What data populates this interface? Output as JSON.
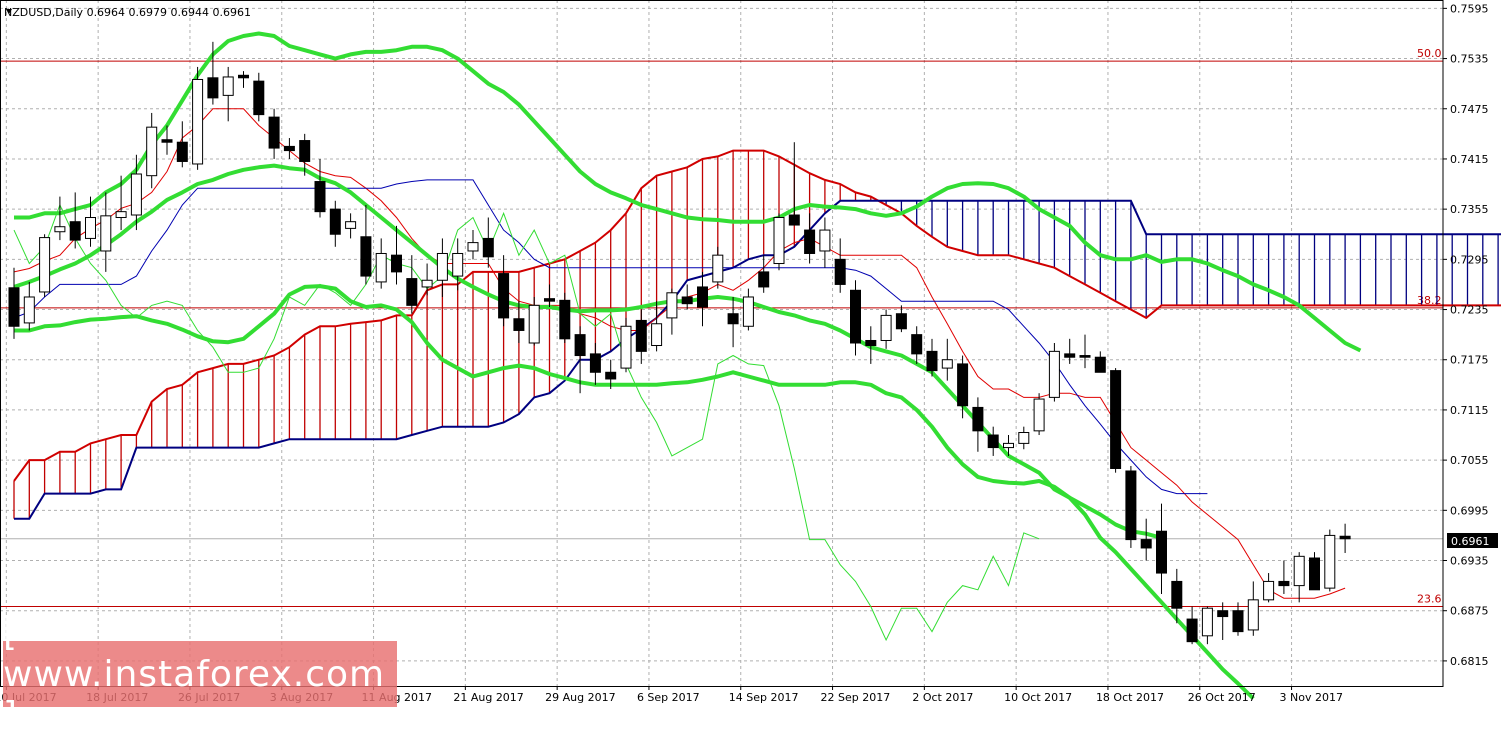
{
  "chart_data": {
    "type": "candlestick",
    "title": "NZDUSD,Daily  0.6964  0.6979  0.6944  0.6961",
    "symbol": "NZDUSD",
    "timeframe": "Daily",
    "last_price": "0.6961",
    "ylim": [
      0.6785,
      0.7605
    ],
    "y_ticks": [
      "0.7595",
      "0.7535",
      "0.7475",
      "0.7415",
      "0.7355",
      "0.7295",
      "0.7235",
      "0.7175",
      "0.7115",
      "0.7055",
      "0.6995",
      "0.6935",
      "0.6875",
      "0.6815"
    ],
    "x_ticks": [
      "10 Jul 2017",
      "18 Jul 2017",
      "26 Jul 2017",
      "3 Aug 2017",
      "11 Aug 2017",
      "21 Aug 2017",
      "29 Aug 2017",
      "6 Sep 2017",
      "14 Sep 2017",
      "22 Sep 2017",
      "2 Oct 2017",
      "10 Oct 2017",
      "18 Oct 2017",
      "26 Oct 2017",
      "3 Nov 2017"
    ],
    "fib_levels": [
      {
        "label": "50.0",
        "price": 0.7532
      },
      {
        "label": "38.2",
        "price": 0.7237
      },
      {
        "label": "23.6",
        "price": 0.688
      }
    ],
    "candles": [
      {
        "o": 0.7261,
        "h": 0.7285,
        "l": 0.72,
        "c": 0.7215
      },
      {
        "o": 0.7219,
        "h": 0.7268,
        "l": 0.721,
        "c": 0.725
      },
      {
        "o": 0.7256,
        "h": 0.7325,
        "l": 0.725,
        "c": 0.7321
      },
      {
        "o": 0.7328,
        "h": 0.737,
        "l": 0.7318,
        "c": 0.7334
      },
      {
        "o": 0.734,
        "h": 0.7375,
        "l": 0.7308,
        "c": 0.7318
      },
      {
        "o": 0.732,
        "h": 0.737,
        "l": 0.731,
        "c": 0.7345
      },
      {
        "o": 0.7305,
        "h": 0.7375,
        "l": 0.728,
        "c": 0.7347
      },
      {
        "o": 0.7345,
        "h": 0.7395,
        "l": 0.733,
        "c": 0.7352
      },
      {
        "o": 0.7348,
        "h": 0.742,
        "l": 0.733,
        "c": 0.7397
      },
      {
        "o": 0.7395,
        "h": 0.747,
        "l": 0.738,
        "c": 0.7453
      },
      {
        "o": 0.7438,
        "h": 0.7455,
        "l": 0.742,
        "c": 0.7435
      },
      {
        "o": 0.7435,
        "h": 0.746,
        "l": 0.7405,
        "c": 0.7412
      },
      {
        "o": 0.7409,
        "h": 0.7525,
        "l": 0.7402,
        "c": 0.751
      },
      {
        "o": 0.7512,
        "h": 0.7555,
        "l": 0.748,
        "c": 0.7488
      },
      {
        "o": 0.7491,
        "h": 0.7525,
        "l": 0.746,
        "c": 0.7513
      },
      {
        "o": 0.7515,
        "h": 0.752,
        "l": 0.75,
        "c": 0.7512
      },
      {
        "o": 0.7508,
        "h": 0.7518,
        "l": 0.746,
        "c": 0.7468
      },
      {
        "o": 0.7465,
        "h": 0.7475,
        "l": 0.7415,
        "c": 0.7428
      },
      {
        "o": 0.743,
        "h": 0.744,
        "l": 0.7415,
        "c": 0.7425
      },
      {
        "o": 0.7437,
        "h": 0.7445,
        "l": 0.7395,
        "c": 0.7412
      },
      {
        "o": 0.7388,
        "h": 0.7415,
        "l": 0.7345,
        "c": 0.7352
      },
      {
        "o": 0.7355,
        "h": 0.7365,
        "l": 0.731,
        "c": 0.7325
      },
      {
        "o": 0.7332,
        "h": 0.735,
        "l": 0.732,
        "c": 0.734
      },
      {
        "o": 0.7322,
        "h": 0.736,
        "l": 0.7265,
        "c": 0.7275
      },
      {
        "o": 0.7268,
        "h": 0.732,
        "l": 0.726,
        "c": 0.7302
      },
      {
        "o": 0.73,
        "h": 0.7335,
        "l": 0.7265,
        "c": 0.728
      },
      {
        "o": 0.7272,
        "h": 0.73,
        "l": 0.723,
        "c": 0.724
      },
      {
        "o": 0.7262,
        "h": 0.729,
        "l": 0.7252,
        "c": 0.727
      },
      {
        "o": 0.727,
        "h": 0.732,
        "l": 0.725,
        "c": 0.7302
      },
      {
        "o": 0.7275,
        "h": 0.732,
        "l": 0.7258,
        "c": 0.7302
      },
      {
        "o": 0.7305,
        "h": 0.733,
        "l": 0.7295,
        "c": 0.7315
      },
      {
        "o": 0.732,
        "h": 0.7345,
        "l": 0.7285,
        "c": 0.7298
      },
      {
        "o": 0.7278,
        "h": 0.73,
        "l": 0.7215,
        "c": 0.7225
      },
      {
        "o": 0.7224,
        "h": 0.7245,
        "l": 0.7195,
        "c": 0.721
      },
      {
        "o": 0.7195,
        "h": 0.725,
        "l": 0.7192,
        "c": 0.724
      },
      {
        "o": 0.7248,
        "h": 0.7265,
        "l": 0.7238,
        "c": 0.7245
      },
      {
        "o": 0.7246,
        "h": 0.7255,
        "l": 0.7195,
        "c": 0.72
      },
      {
        "o": 0.7205,
        "h": 0.7215,
        "l": 0.7135,
        "c": 0.718
      },
      {
        "o": 0.7182,
        "h": 0.7195,
        "l": 0.7145,
        "c": 0.716
      },
      {
        "o": 0.716,
        "h": 0.7175,
        "l": 0.714,
        "c": 0.7152
      },
      {
        "o": 0.7165,
        "h": 0.7225,
        "l": 0.716,
        "c": 0.7215
      },
      {
        "o": 0.7222,
        "h": 0.7235,
        "l": 0.717,
        "c": 0.7185
      },
      {
        "o": 0.7192,
        "h": 0.7245,
        "l": 0.7185,
        "c": 0.7218
      },
      {
        "o": 0.7225,
        "h": 0.726,
        "l": 0.7205,
        "c": 0.7255
      },
      {
        "o": 0.725,
        "h": 0.7265,
        "l": 0.7235,
        "c": 0.7242
      },
      {
        "o": 0.7262,
        "h": 0.728,
        "l": 0.7215,
        "c": 0.7238
      },
      {
        "o": 0.7268,
        "h": 0.731,
        "l": 0.726,
        "c": 0.73
      },
      {
        "o": 0.723,
        "h": 0.725,
        "l": 0.719,
        "c": 0.7218
      },
      {
        "o": 0.7215,
        "h": 0.726,
        "l": 0.721,
        "c": 0.725
      },
      {
        "o": 0.728,
        "h": 0.73,
        "l": 0.7255,
        "c": 0.7262
      },
      {
        "o": 0.729,
        "h": 0.735,
        "l": 0.7282,
        "c": 0.7345
      },
      {
        "o": 0.7348,
        "h": 0.7435,
        "l": 0.734,
        "c": 0.7336
      },
      {
        "o": 0.733,
        "h": 0.735,
        "l": 0.729,
        "c": 0.7302
      },
      {
        "o": 0.7305,
        "h": 0.7345,
        "l": 0.7285,
        "c": 0.733
      },
      {
        "o": 0.7295,
        "h": 0.732,
        "l": 0.7255,
        "c": 0.7265
      },
      {
        "o": 0.7258,
        "h": 0.727,
        "l": 0.718,
        "c": 0.7195
      },
      {
        "o": 0.7198,
        "h": 0.7215,
        "l": 0.717,
        "c": 0.7192
      },
      {
        "o": 0.7198,
        "h": 0.7235,
        "l": 0.7188,
        "c": 0.7228
      },
      {
        "o": 0.723,
        "h": 0.724,
        "l": 0.7208,
        "c": 0.7212
      },
      {
        "o": 0.7205,
        "h": 0.7215,
        "l": 0.717,
        "c": 0.7182
      },
      {
        "o": 0.7185,
        "h": 0.72,
        "l": 0.7155,
        "c": 0.7162
      },
      {
        "o": 0.7165,
        "h": 0.72,
        "l": 0.715,
        "c": 0.7175
      },
      {
        "o": 0.717,
        "h": 0.718,
        "l": 0.7105,
        "c": 0.712
      },
      {
        "o": 0.7118,
        "h": 0.713,
        "l": 0.7065,
        "c": 0.709
      },
      {
        "o": 0.7085,
        "h": 0.7095,
        "l": 0.706,
        "c": 0.707
      },
      {
        "o": 0.707,
        "h": 0.7085,
        "l": 0.706,
        "c": 0.7075
      },
      {
        "o": 0.7075,
        "h": 0.7095,
        "l": 0.7068,
        "c": 0.7088
      },
      {
        "o": 0.709,
        "h": 0.7135,
        "l": 0.7085,
        "c": 0.7128
      },
      {
        "o": 0.713,
        "h": 0.7195,
        "l": 0.7125,
        "c": 0.7185
      },
      {
        "o": 0.7182,
        "h": 0.72,
        "l": 0.717,
        "c": 0.7178
      },
      {
        "o": 0.718,
        "h": 0.7205,
        "l": 0.7165,
        "c": 0.7178
      },
      {
        "o": 0.7178,
        "h": 0.7185,
        "l": 0.716,
        "c": 0.716
      },
      {
        "o": 0.7162,
        "h": 0.7165,
        "l": 0.704,
        "c": 0.7045
      },
      {
        "o": 0.7042,
        "h": 0.7048,
        "l": 0.695,
        "c": 0.696
      },
      {
        "o": 0.696,
        "h": 0.6985,
        "l": 0.6935,
        "c": 0.695
      },
      {
        "o": 0.697,
        "h": 0.7003,
        "l": 0.6895,
        "c": 0.692
      },
      {
        "o": 0.691,
        "h": 0.6925,
        "l": 0.686,
        "c": 0.6878
      },
      {
        "o": 0.6865,
        "h": 0.688,
        "l": 0.6835,
        "c": 0.6838
      },
      {
        "o": 0.6845,
        "h": 0.688,
        "l": 0.6835,
        "c": 0.6878
      },
      {
        "o": 0.6875,
        "h": 0.6885,
        "l": 0.684,
        "c": 0.6868
      },
      {
        "o": 0.6875,
        "h": 0.6885,
        "l": 0.6845,
        "c": 0.685
      },
      {
        "o": 0.6852,
        "h": 0.691,
        "l": 0.6845,
        "c": 0.6888
      },
      {
        "o": 0.6888,
        "h": 0.692,
        "l": 0.6885,
        "c": 0.691
      },
      {
        "o": 0.691,
        "h": 0.6935,
        "l": 0.6895,
        "c": 0.6905
      },
      {
        "o": 0.6905,
        "h": 0.6945,
        "l": 0.6885,
        "c": 0.694
      },
      {
        "o": 0.6938,
        "h": 0.6945,
        "l": 0.69,
        "c": 0.69
      },
      {
        "o": 0.6902,
        "h": 0.6972,
        "l": 0.6898,
        "c": 0.6965
      },
      {
        "o": 0.6964,
        "h": 0.6979,
        "l": 0.6944,
        "c": 0.6961
      }
    ],
    "tenkan_sen": [
      0.728,
      0.7284,
      0.7293,
      0.73,
      0.732,
      0.7332,
      0.7342,
      0.7356,
      0.7362,
      0.7375,
      0.74,
      0.744,
      0.7455,
      0.7475,
      0.7475,
      0.7475,
      0.7455,
      0.744,
      0.7425,
      0.741,
      0.74,
      0.7395,
      0.7393,
      0.738,
      0.7365,
      0.7345,
      0.732,
      0.73,
      0.729,
      0.729,
      0.729,
      0.729,
      0.726,
      0.7245,
      0.724,
      0.724,
      0.724,
      0.723,
      0.7225,
      0.7215,
      0.721,
      0.721,
      0.7225,
      0.724,
      0.725,
      0.7255,
      0.7265,
      0.7258,
      0.727,
      0.7285,
      0.7305,
      0.7315,
      0.732,
      0.731,
      0.73,
      0.73,
      0.73,
      0.73,
      0.73,
      0.7285,
      0.725,
      0.7218,
      0.7185,
      0.7155,
      0.714,
      0.714,
      0.713,
      0.713,
      0.7135,
      0.7135,
      0.713,
      0.713,
      0.71,
      0.707,
      0.7055,
      0.704,
      0.7025,
      0.7005,
      0.699,
      0.6975,
      0.696,
      0.693,
      0.69,
      0.689,
      0.689,
      0.689,
      0.6895,
      0.6902
    ],
    "kijun_sen": [
      0.7225,
      0.7232,
      0.725,
      0.7265,
      0.7265,
      0.7265,
      0.7265,
      0.7265,
      0.7275,
      0.7305,
      0.733,
      0.736,
      0.738,
      0.738,
      0.738,
      0.738,
      0.738,
      0.738,
      0.738,
      0.738,
      0.738,
      0.738,
      0.738,
      0.738,
      0.738,
      0.7385,
      0.7388,
      0.739,
      0.739,
      0.739,
      0.739,
      0.736,
      0.733,
      0.7315,
      0.7295,
      0.7285,
      0.7285,
      0.7285,
      0.7285,
      0.7285,
      0.7285,
      0.7285,
      0.7285,
      0.7285,
      0.7285,
      0.7285,
      0.7285,
      0.7285,
      0.7285,
      0.7285,
      0.7285,
      0.7285,
      0.7285,
      0.7285,
      0.7285,
      0.7282,
      0.7275,
      0.726,
      0.7245,
      0.7245,
      0.7245,
      0.7245,
      0.7245,
      0.7245,
      0.7245,
      0.7235,
      0.7215,
      0.7195,
      0.7172,
      0.7145,
      0.712,
      0.7098,
      0.7075,
      0.7055,
      0.7035,
      0.702,
      0.7015,
      0.7015,
      0.7015
    ],
    "senkou_span_a": [
      0.703,
      0.7055,
      0.7055,
      0.7065,
      0.7065,
      0.7075,
      0.708,
      0.7085,
      0.7085,
      0.7125,
      0.714,
      0.7145,
      0.716,
      0.7165,
      0.717,
      0.717,
      0.7175,
      0.718,
      0.719,
      0.7205,
      0.7215,
      0.7215,
      0.7218,
      0.722,
      0.7222,
      0.7228,
      0.7228,
      0.7258,
      0.7265,
      0.7265,
      0.728,
      0.728,
      0.728,
      0.728,
      0.7285,
      0.729,
      0.7295,
      0.7305,
      0.7315,
      0.733,
      0.735,
      0.738,
      0.7395,
      0.74,
      0.7405,
      0.7415,
      0.7418,
      0.7425,
      0.7425,
      0.7425,
      0.7418,
      0.7408,
      0.7398,
      0.739,
      0.7385,
      0.7375,
      0.737,
      0.736,
      0.735,
      0.7335,
      0.7322,
      0.731,
      0.7305,
      0.73,
      0.73,
      0.73,
      0.7295,
      0.729,
      0.7285,
      0.7275,
      0.7265,
      0.7255,
      0.7245,
      0.7235,
      0.7225,
      0.724,
      0.724,
      0.724,
      0.724,
      0.724,
      0.724,
      0.724,
      0.724,
      0.724,
      0.724,
      0.724,
      0.724,
      0.724,
      0.724,
      0.724,
      0.724,
      0.724,
      0.724,
      0.724,
      0.724,
      0.724,
      0.724,
      0.724,
      0.724,
      0.7235,
      0.7265,
      0.7255,
      0.7235,
      0.721
    ],
    "senkou_span_b": [
      0.6985,
      0.6985,
      0.7015,
      0.7015,
      0.7015,
      0.7015,
      0.702,
      0.702,
      0.707,
      0.707,
      0.707,
      0.707,
      0.707,
      0.707,
      0.707,
      0.707,
      0.707,
      0.7075,
      0.708,
      0.708,
      0.708,
      0.708,
      0.708,
      0.708,
      0.708,
      0.708,
      0.7085,
      0.709,
      0.7095,
      0.7095,
      0.7095,
      0.7095,
      0.71,
      0.711,
      0.713,
      0.7135,
      0.715,
      0.7175,
      0.7175,
      0.7185,
      0.72,
      0.7212,
      0.7225,
      0.7245,
      0.727,
      0.7275,
      0.728,
      0.7285,
      0.7295,
      0.73,
      0.73,
      0.731,
      0.733,
      0.735,
      0.7365,
      0.7365,
      0.7365,
      0.7365,
      0.7365,
      0.7365,
      0.7365,
      0.7365,
      0.7365,
      0.7365,
      0.7365,
      0.7365,
      0.7365,
      0.7365,
      0.7365,
      0.7365,
      0.7365,
      0.7365,
      0.7365,
      0.7365,
      0.7325,
      0.7325,
      0.7325,
      0.7325,
      0.7325,
      0.7325,
      0.7325,
      0.7325,
      0.7325,
      0.7325,
      0.7325,
      0.7325,
      0.7325,
      0.7325,
      0.7325,
      0.7325,
      0.7325,
      0.7325,
      0.7325,
      0.7325,
      0.7325,
      0.7325,
      0.7325,
      0.7325,
      0.7325,
      0.7325,
      0.7325,
      0.7325,
      0.7325,
      0.7325,
      0.7325
    ],
    "chikou_span": [
      0.733,
      0.729,
      0.731,
      0.736,
      0.732,
      0.729,
      0.727,
      0.724,
      0.7225,
      0.724,
      0.7245,
      0.724,
      0.721,
      0.719,
      0.716,
      0.716,
      0.7165,
      0.72,
      0.725,
      0.724,
      0.7265,
      0.7255,
      0.724,
      0.7265,
      0.73,
      0.729,
      0.7285,
      0.726,
      0.7275,
      0.733,
      0.7345,
      0.7305,
      0.735,
      0.73,
      0.733,
      0.729,
      0.73,
      0.723,
      0.7215,
      0.723,
      0.717,
      0.713,
      0.71,
      0.706,
      0.707,
      0.708,
      0.717,
      0.718,
      0.717,
      0.7168,
      0.712,
      0.7045,
      0.696,
      0.696,
      0.693,
      0.691,
      0.688,
      0.684,
      0.6878,
      0.6878,
      0.685,
      0.6885,
      0.6905,
      0.69,
      0.694,
      0.6905,
      0.6968,
      0.6961
    ]
  },
  "indicators": {
    "bb_mid": [
      0.7262,
      0.7268,
      0.7275,
      0.7283,
      0.729,
      0.73,
      0.7312,
      0.7325,
      0.734,
      0.7352,
      0.7366,
      0.7375,
      0.7385,
      0.739,
      0.7397,
      0.7402,
      0.7405,
      0.7407,
      0.7404,
      0.7402,
      0.7392,
      0.7386,
      0.7375,
      0.736,
      0.7345,
      0.733,
      0.7315,
      0.73,
      0.7285,
      0.7272,
      0.7262,
      0.7253,
      0.7245,
      0.724,
      0.7238,
      0.7238,
      0.7235,
      0.7233,
      0.7234,
      0.7234,
      0.7235,
      0.7238,
      0.7242,
      0.7245,
      0.7245,
      0.7248,
      0.725,
      0.7248,
      0.7244,
      0.7238,
      0.7232,
      0.7228,
      0.7222,
      0.7218,
      0.721,
      0.72,
      0.719,
      0.7185,
      0.718,
      0.717,
      0.716,
      0.714,
      0.712,
      0.71,
      0.708,
      0.706,
      0.705,
      0.704,
      0.702,
      0.701,
      0.7,
      0.699,
      0.6978,
      0.697,
      0.6967,
      0.6962
    ],
    "bb_upper": [
      0.7345,
      0.7345,
      0.735,
      0.735,
      0.7355,
      0.736,
      0.7375,
      0.7385,
      0.7402,
      0.7432,
      0.7455,
      0.7485,
      0.7515,
      0.754,
      0.7556,
      0.7562,
      0.7565,
      0.7562,
      0.755,
      0.7545,
      0.754,
      0.7535,
      0.754,
      0.7543,
      0.7543,
      0.7545,
      0.7549,
      0.7549,
      0.7545,
      0.7535,
      0.752,
      0.7505,
      0.7495,
      0.748,
      0.746,
      0.744,
      0.742,
      0.74,
      0.7385,
      0.7375,
      0.7368,
      0.736,
      0.7355,
      0.735,
      0.7345,
      0.7343,
      0.7342,
      0.734,
      0.734,
      0.734,
      0.7345,
      0.7355,
      0.736,
      0.7358,
      0.7357,
      0.7355,
      0.735,
      0.7347,
      0.735,
      0.7358,
      0.737,
      0.738,
      0.7385,
      0.7386,
      0.7385,
      0.738,
      0.737,
      0.7355,
      0.7345,
      0.7335,
      0.7315,
      0.73,
      0.7295,
      0.7295,
      0.73,
      0.7292,
      0.7295,
      0.7295,
      0.729,
      0.7282,
      0.7275,
      0.7265,
      0.7258,
      0.725,
      0.724,
      0.7225,
      0.721,
      0.7195,
      0.7186
    ],
    "bb_lower": [
      0.721,
      0.721,
      0.7215,
      0.7216,
      0.722,
      0.7223,
      0.7224,
      0.7226,
      0.7227,
      0.7222,
      0.7218,
      0.7211,
      0.7203,
      0.7197,
      0.7196,
      0.72,
      0.7215,
      0.723,
      0.7253,
      0.7262,
      0.7263,
      0.726,
      0.7245,
      0.7238,
      0.724,
      0.7235,
      0.722,
      0.7195,
      0.7175,
      0.7165,
      0.7155,
      0.716,
      0.7165,
      0.7168,
      0.7165,
      0.7158,
      0.7153,
      0.7148,
      0.7145,
      0.7145,
      0.7145,
      0.7145,
      0.7145,
      0.7147,
      0.7148,
      0.7151,
      0.7155,
      0.716,
      0.7155,
      0.715,
      0.7145,
      0.7145,
      0.7145,
      0.7145,
      0.7148,
      0.7148,
      0.7145,
      0.7135,
      0.713,
      0.7115,
      0.7095,
      0.707,
      0.705,
      0.7035,
      0.703,
      0.7028,
      0.7027,
      0.703,
      0.7023,
      0.701,
      0.699,
      0.6962,
      0.6945,
      0.6925,
      0.6905,
      0.6885,
      0.6865,
      0.6845,
      0.6825,
      0.6805,
      0.6788,
      0.677
    ]
  },
  "watermark": "[ www.instaforex.com ]"
}
